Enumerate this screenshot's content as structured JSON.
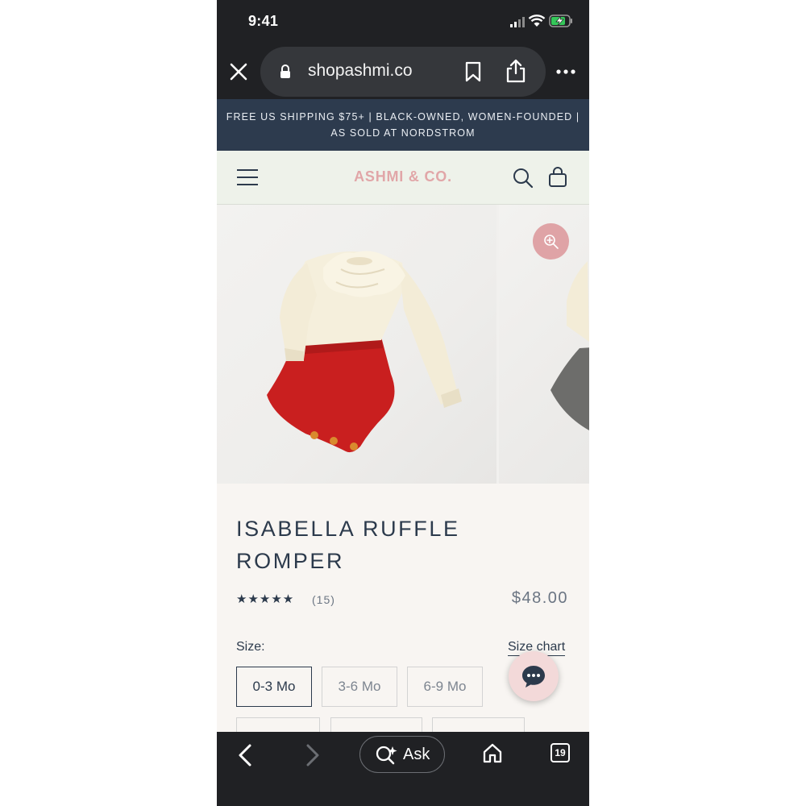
{
  "status_bar": {
    "time": "9:41"
  },
  "browser": {
    "url": "shopashmi.co"
  },
  "announcement": {
    "line1": "FREE US SHIPPING $75+ | BLACK-OWNED, WOMEN-FOUNDED |",
    "line2": "AS SOLD AT NORDSTROM"
  },
  "header": {
    "brand": "ASHMI & CO."
  },
  "product": {
    "title_line1": "ISABELLA RUFFLE",
    "title_line2": "ROMPER",
    "stars": "★★★★★",
    "rating_value": 5,
    "reviews": "(15)",
    "price": "$48.00",
    "size_label": "Size:",
    "size_chart": "Size chart",
    "sizes": [
      "0-3 Mo",
      "3-6 Mo",
      "6-9 Mo"
    ],
    "selected_size": "0-3 Mo"
  },
  "bottom_bar": {
    "ask_label": "Ask",
    "tab_count": "19"
  },
  "colors": {
    "announcement_bg": "#2d3b4e",
    "brand": "#e1a6a8",
    "text_navy": "#2c3a4c",
    "romper_red": "#c91f1f",
    "zoom_pink": "#dfa3a6"
  }
}
